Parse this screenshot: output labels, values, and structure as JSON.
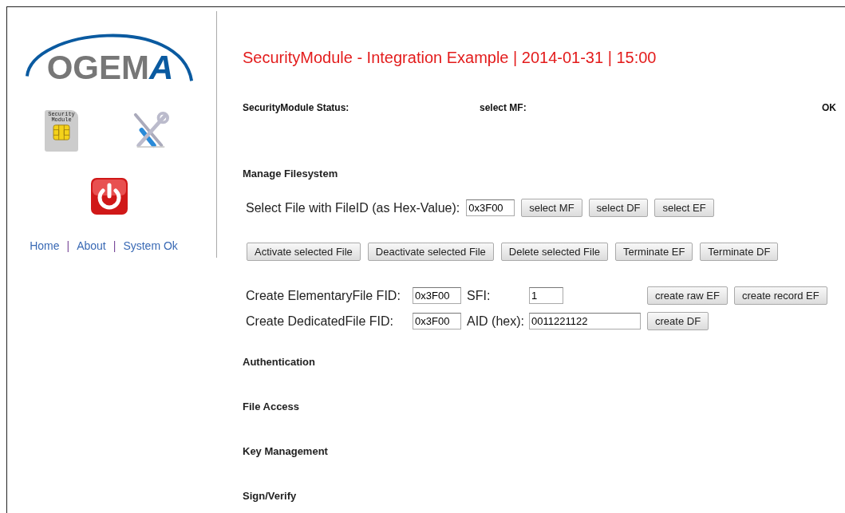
{
  "logo": {
    "text": "OGEM",
    "accent": "A"
  },
  "sim_card": {
    "label": "Security Module"
  },
  "nav_links": [
    "Home",
    "About",
    "System Ok"
  ],
  "nav_separator": "|",
  "title": "SecurityModule - Integration Example | 2014-01-31 | 15:00",
  "status": {
    "label": "SecurityModule Status:",
    "action": "select MF:",
    "result": "OK"
  },
  "manage_filesystem": {
    "heading": "Manage Filesystem",
    "select_label": "Select File with FileID (as Hex-Value):",
    "select_value": "0x3F00",
    "select_buttons": [
      "select MF",
      "select DF",
      "select EF"
    ],
    "file_buttons": [
      "Activate selected File",
      "Deactivate selected File",
      "Delete selected File",
      "Terminate EF",
      "Terminate DF"
    ],
    "create_ef": {
      "label": "Create ElementaryFile FID:",
      "fid": "0x3F00",
      "param_label": "SFI:",
      "param_value": "1",
      "buttons": [
        "create raw EF",
        "create record EF"
      ]
    },
    "create_df": {
      "label": "Create DedicatedFile  FID:",
      "fid": "0x3F00",
      "param_label": "AID (hex):",
      "param_value": "0011221122",
      "buttons": [
        "create DF"
      ]
    }
  },
  "sections": [
    "Authentication",
    "File Access",
    "Key Management",
    "Sign/Verify"
  ]
}
